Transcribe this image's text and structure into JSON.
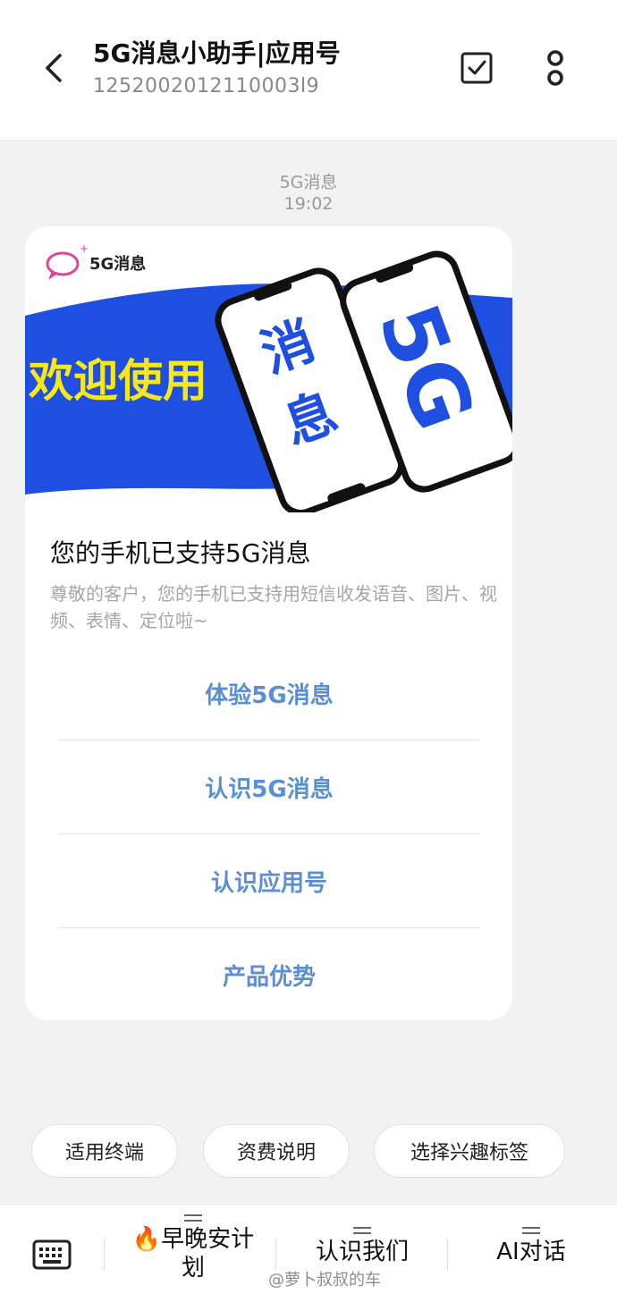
{
  "header": {
    "title": "5G消息小助手|应用号",
    "number": "1252002012110003l9",
    "back_icon": "chevron-left-icon",
    "checkbox_icon": "checkbox-icon",
    "more_icon": "more-vertical-icon"
  },
  "timestamp": {
    "label": "5G消息",
    "time": "19:02"
  },
  "card": {
    "banner": {
      "logo_text": "5G消息",
      "welcome_text": "欢迎使用",
      "phone_left_text_1": "消",
      "phone_left_text_2": "息",
      "phone_right_text": "5G"
    },
    "title": "您的手机已支持5G消息",
    "description": "尊敬的客户，您的手机已支持用短信收发语音、图片、视频、表情、定位啦~",
    "actions": [
      {
        "label": "体验5G消息"
      },
      {
        "label": "认识5G消息"
      },
      {
        "label": "认识应用号"
      },
      {
        "label": "产品优势"
      }
    ]
  },
  "chips": [
    {
      "label": "适用终端"
    },
    {
      "label": "资费说明"
    },
    {
      "label": "选择兴趣标签"
    }
  ],
  "bottom_bar": {
    "keyboard_icon": "keyboard-icon",
    "menus": [
      {
        "label": "🔥早晚安计划"
      },
      {
        "label": "认识我们"
      },
      {
        "label": "AI对话"
      }
    ]
  },
  "watermark": "@萝卜叔叔的车",
  "colors": {
    "accent_blue": "#1f4fe0",
    "action_text": "#5a8fd6",
    "welcome_yellow": "#f7e81a"
  }
}
